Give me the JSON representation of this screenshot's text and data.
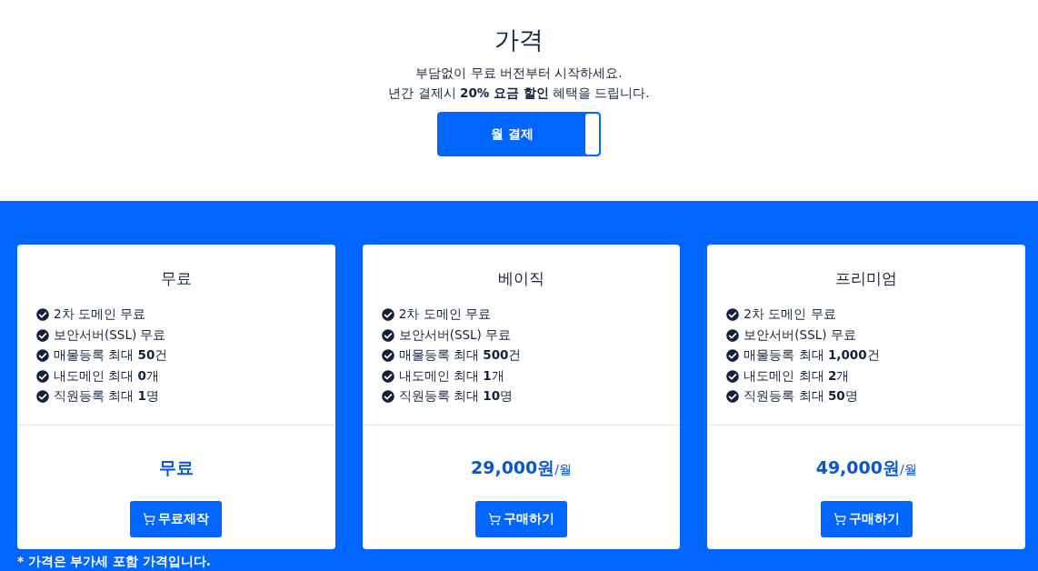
{
  "header": {
    "title": "가격",
    "subtitle_lines": [
      "부담없이 무료 버전부터 시작하세요.",
      "년간 결제시 **20% 요금 할인** 혜택을 드립니다."
    ],
    "billing_toggle": {
      "label": "월 결제",
      "on": true
    }
  },
  "plans": [
    {
      "name": "무료",
      "features": [
        "2차 도메인 무료",
        "보안서버(SSL) 무료",
        "매물등록 최대 **50**건",
        "내도메인 최대 **0**개",
        "직원등록 최대 **1**명"
      ],
      "price": "무료",
      "button": {
        "label": "무료제작"
      }
    },
    {
      "name": "베이직",
      "features": [
        "2차 도메인 무료",
        "보안서버(SSL) 무료",
        "매물등록 최대 **500**건",
        "내도메인 최대 **1**개",
        "직원등록 최대 **10**명"
      ],
      "price": "29,000원",
      "price_unit": "/월",
      "button": {
        "label": "구매하기"
      }
    },
    {
      "name": "프리미엄",
      "features": [
        "2차 도메인 무료",
        "보안서버(SSL) 무료",
        "매물등록 최대 **1,000**건",
        "내도메인 최대 **2**개",
        "직원등록 최대 **50**명"
      ],
      "price": "49,000원",
      "price_unit": "/월",
      "button": {
        "label": "구매하기"
      }
    }
  ],
  "footnote": "* 가격은 부가세 포함 가격입니다."
}
